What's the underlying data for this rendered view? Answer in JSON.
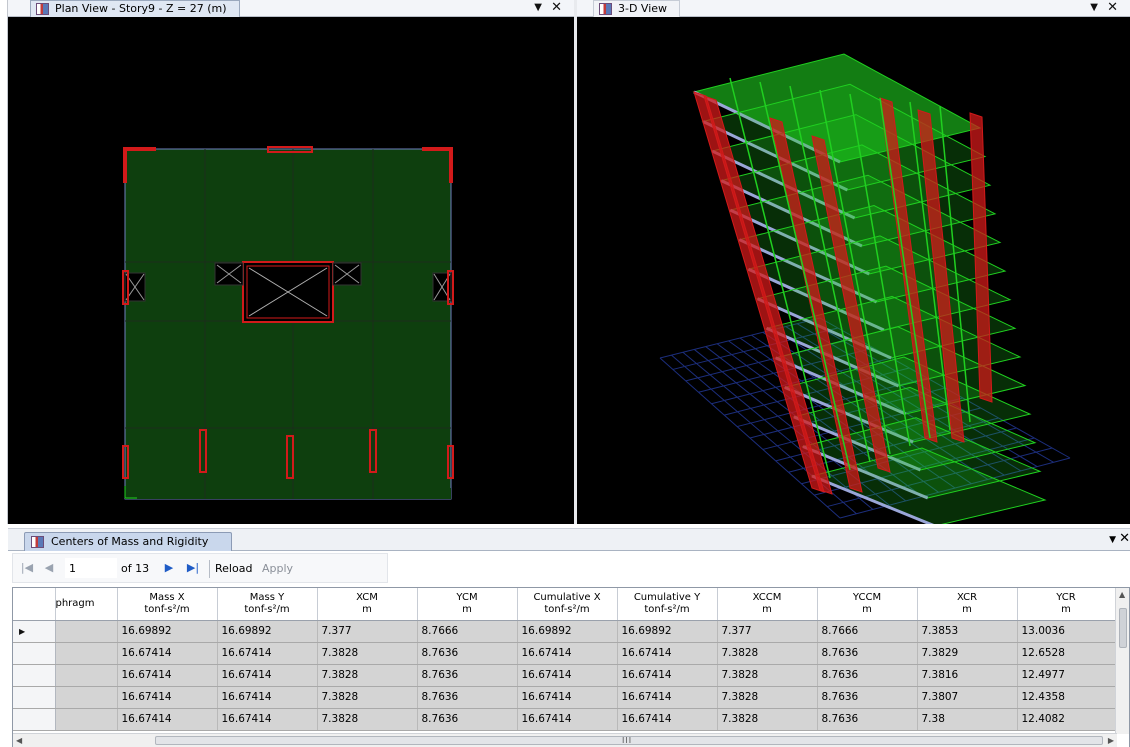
{
  "plan_view": {
    "title": "Plan View - Story9 - Z = 27 (m)",
    "dropdown": "▼",
    "close": "✕"
  },
  "view_3d": {
    "title": "3-D View",
    "dropdown": "▼",
    "close": "✕"
  },
  "table_panel": {
    "title": "Centers of Mass and Rigidity",
    "dropdown": "▼",
    "close": "✕",
    "toolbar": {
      "page_value": "1",
      "page_of": "of 13",
      "reload_label": "Reload",
      "apply_label": "Apply"
    },
    "columns": [
      {
        "name": "phragm",
        "unit": ""
      },
      {
        "name": "Mass X",
        "unit": "tonf-s²/m"
      },
      {
        "name": "Mass Y",
        "unit": "tonf-s²/m"
      },
      {
        "name": "XCM",
        "unit": "m"
      },
      {
        "name": "YCM",
        "unit": "m"
      },
      {
        "name": "Cumulative X",
        "unit": "tonf-s²/m"
      },
      {
        "name": "Cumulative Y",
        "unit": "tonf-s²/m"
      },
      {
        "name": "XCCM",
        "unit": "m"
      },
      {
        "name": "YCCM",
        "unit": "m"
      },
      {
        "name": "XCR",
        "unit": "m"
      },
      {
        "name": "YCR",
        "unit": "m"
      }
    ],
    "rows": [
      {
        "values": [
          "",
          "16.69892",
          "16.69892",
          "7.377",
          "8.7666",
          "16.69892",
          "16.69892",
          "7.377",
          "8.7666",
          "7.3853",
          "13.0036"
        ]
      },
      {
        "values": [
          "",
          "16.67414",
          "16.67414",
          "7.3828",
          "8.7636",
          "16.67414",
          "16.67414",
          "7.3828",
          "8.7636",
          "7.3829",
          "12.6528"
        ]
      },
      {
        "values": [
          "",
          "16.67414",
          "16.67414",
          "7.3828",
          "8.7636",
          "16.67414",
          "16.67414",
          "7.3828",
          "8.7636",
          "7.3816",
          "12.4977"
        ]
      },
      {
        "values": [
          "",
          "16.67414",
          "16.67414",
          "7.3828",
          "8.7636",
          "16.67414",
          "16.67414",
          "7.3828",
          "8.7636",
          "7.3807",
          "12.4358"
        ]
      },
      {
        "values": [
          "",
          "16.67414",
          "16.67414",
          "7.3828",
          "8.7636",
          "16.67414",
          "16.67414",
          "7.3828",
          "8.7636",
          "7.38",
          "12.4082"
        ]
      }
    ],
    "scroll_grip": "III"
  },
  "colors": {
    "slab": "#0e3f0e",
    "frame_red": "#d21a1a",
    "frame_green": "#20d020",
    "beam_blue": "#9aa6d8",
    "grid_blue": "#1c2e7c",
    "accent": "#1f5cc6"
  }
}
